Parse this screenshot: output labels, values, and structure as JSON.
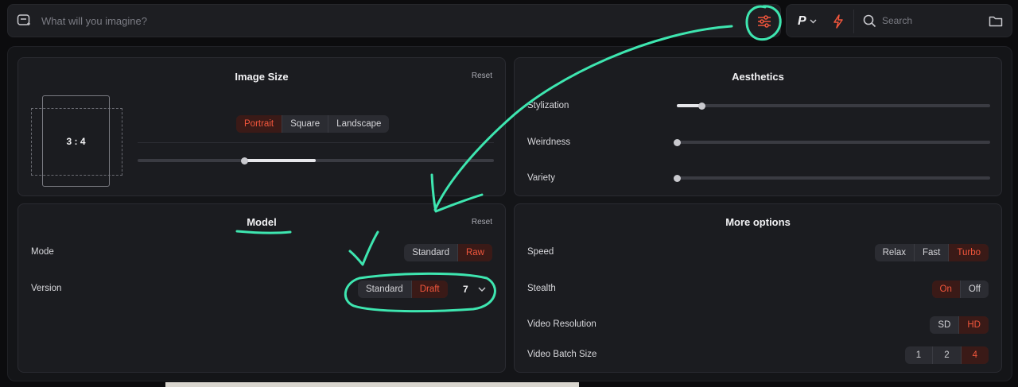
{
  "prompt": {
    "placeholder": "What will you imagine?"
  },
  "header": {
    "profile_letter": "P",
    "search_placeholder": "Search"
  },
  "image_size": {
    "title": "Image Size",
    "reset": "Reset",
    "ratio": "3 : 4",
    "orientations": [
      "Portrait",
      "Square",
      "Landscape"
    ],
    "selected": "Portrait"
  },
  "aesthetics": {
    "title": "Aesthetics",
    "sliders": [
      {
        "label": "Stylization",
        "value": 0.08
      },
      {
        "label": "Weirdness",
        "value": 0.0
      },
      {
        "label": "Variety",
        "value": 0.0
      }
    ]
  },
  "model": {
    "title": "Model",
    "reset": "Reset",
    "mode_label": "Mode",
    "modes": [
      "Standard",
      "Raw"
    ],
    "mode_selected": "Raw",
    "version_label": "Version",
    "version_modes": [
      "Standard",
      "Draft"
    ],
    "version_mode_selected": "Draft",
    "version": "7"
  },
  "more_options": {
    "title": "More options",
    "speed_label": "Speed",
    "speeds": [
      "Relax",
      "Fast",
      "Turbo"
    ],
    "speed_selected": "Turbo",
    "stealth_label": "Stealth",
    "stealth": [
      "On",
      "Off"
    ],
    "stealth_selected": "On",
    "video_res_label": "Video Resolution",
    "video_res": [
      "SD",
      "HD"
    ],
    "video_res_selected": "HD",
    "batch_label": "Video Batch Size",
    "batch": [
      "1",
      "2",
      "4"
    ],
    "batch_selected": "4"
  },
  "colors": {
    "accent": "#f2563c",
    "annotation": "#3ee6b0"
  }
}
